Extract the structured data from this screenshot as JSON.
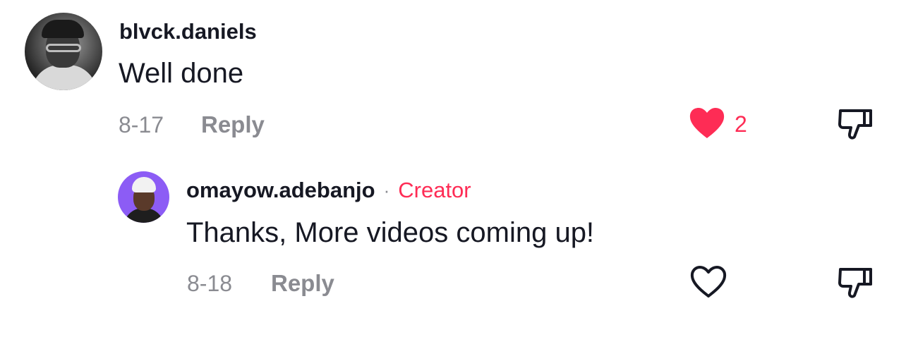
{
  "comments": [
    {
      "username": "blvck.daniels",
      "text": "Well done",
      "date": "8-17",
      "reply_label": "Reply",
      "like_count": "2",
      "liked": true,
      "avatar_icon": "user-avatar-photo"
    }
  ],
  "reply": {
    "username": "omayow.adebanjo",
    "separator": "·",
    "badge": "Creator",
    "text": "Thanks, More videos coming up!",
    "date": "8-18",
    "reply_label": "Reply",
    "liked": false,
    "avatar_icon": "creator-avatar-photo"
  },
  "colors": {
    "accent": "#fe2c55",
    "text": "#161823",
    "muted": "#8a8b91",
    "avatar_bg": "#8c5cf5"
  }
}
